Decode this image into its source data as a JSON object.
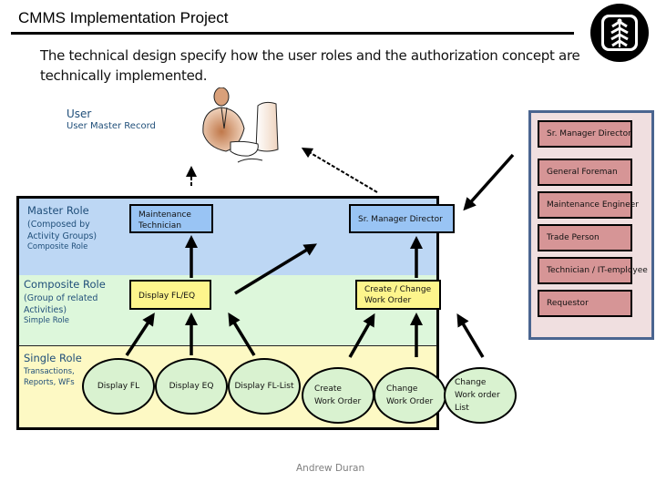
{
  "header": {
    "title": "CMMS Implementation Project",
    "subtitle": "The technical design specify how the user roles and the authorization concept are technically implemented.",
    "logo_icon": "college-district-seal-icon"
  },
  "user": {
    "label": "User",
    "master_record": "User Master Record",
    "illustration": "person-at-computer-icon"
  },
  "bands": {
    "master": {
      "title": "Master Role",
      "sub": "(Composed by Activity Groups)",
      "sub2": "Composite Role",
      "roles": [
        "Maintenance Technician",
        "Sr. Manager Director"
      ]
    },
    "composite": {
      "title": "Composite Role",
      "sub": "(Group of related Activities)",
      "sub2": "Simple Role",
      "roles": [
        "Display FL/EQ",
        "Create / Change Work Order"
      ]
    },
    "single": {
      "title": "Single Role",
      "sub": "Transactions, Reports, WFs",
      "activities": [
        "Display FL",
        "Display EQ",
        "Display FL-List",
        "Create Work Order",
        "Change Work Order",
        "Change Work order List"
      ]
    }
  },
  "job_titles": [
    "Sr. Manager Director",
    "General Foreman",
    "Maintenance Engineer",
    "Trade Person",
    "Technician / IT-employee",
    "Requestor"
  ],
  "footer": {
    "author": "Andrew Duran"
  },
  "colors": {
    "master_band": "#bdd7f4",
    "composite_band": "#ddf7db",
    "single_band": "#fdf9c4",
    "role_box_blue": "#99c4f4",
    "role_box_yellow": "#fdf58c",
    "activity_oval": "#d9f2d0",
    "job_panel": "#f0dfe0",
    "job_box": "#d69596",
    "label_blue": "#1f4e79"
  }
}
